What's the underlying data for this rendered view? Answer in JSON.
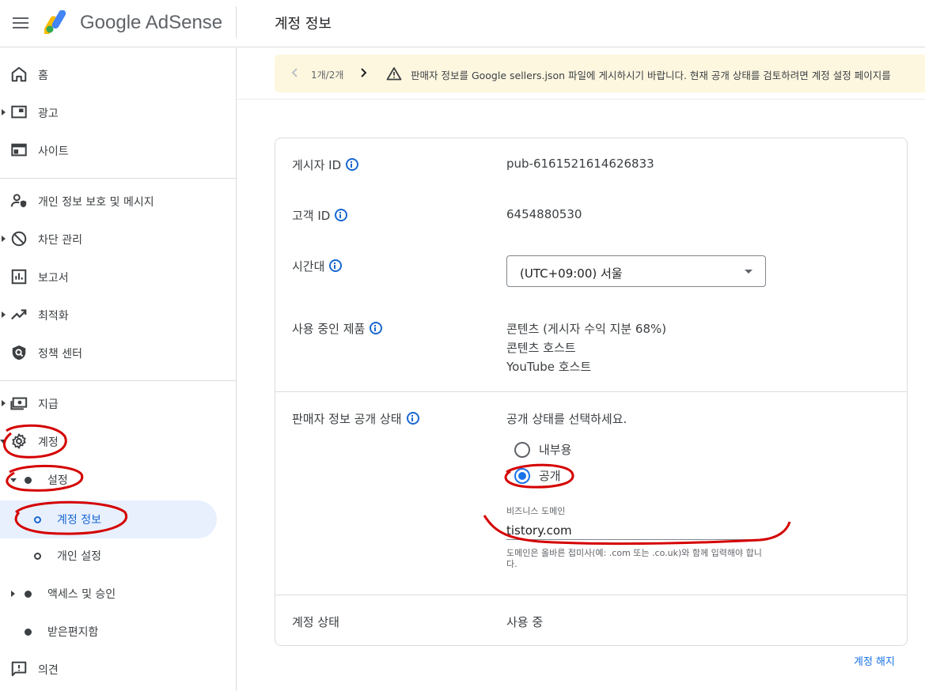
{
  "header": {
    "brand": "Google AdSense",
    "page_title": "계정 정보"
  },
  "sidebar": {
    "items": {
      "home": "홈",
      "ads": "광고",
      "sites": "사이트",
      "privacy": "개인 정보 보호 및 메시지",
      "blocking": "차단 관리",
      "reports": "보고서",
      "optimization": "최적화",
      "policy": "정책 센터",
      "payments": "지급",
      "account": "계정",
      "settings": "설정",
      "account_info": "계정 정보",
      "personal_settings": "개인 설정",
      "access": "액세스 및 승인",
      "inbox": "받은편지함",
      "feedback": "의견"
    }
  },
  "banner": {
    "pager": "1개/2개",
    "message": "판매자 정보를 Google sellers.json 파일에 게시하시기 바랍니다. 현재 공개 상태를 검토하려면 계정 설정 페이지를"
  },
  "account": {
    "publisher_id_label": "게시자 ID",
    "publisher_id": "pub-6161521614626833",
    "customer_id_label": "고객 ID",
    "customer_id": "6454880530",
    "timezone_label": "시간대",
    "timezone_value": "(UTC+09:00) 서울",
    "products_label": "사용 중인 제품",
    "products": [
      "콘텐츠 (게시자 수익 지분 68%)",
      "콘텐츠 호스트",
      "YouTube 호스트"
    ],
    "seller_visibility_label": "판매자 정보 공개 상태",
    "visibility_prompt": "공개 상태를 선택하세요.",
    "option_internal": "내부용",
    "option_public": "공개",
    "selected_option": "공개",
    "domain_label": "비즈니스 도메인",
    "domain_value": "tistory.com",
    "domain_helper": "도메인은 올바른 접미사(예: .com 또는 .co.uk)와 함께 입력해야 합니다.",
    "status_label": "계정 상태",
    "status_value": "사용 중",
    "close_account": "계정 해지"
  },
  "colors": {
    "accent": "#1a73e8",
    "active_nav_bg": "#e8f0fe",
    "banner_bg": "#fef7e0",
    "annotation": "#d50000"
  }
}
